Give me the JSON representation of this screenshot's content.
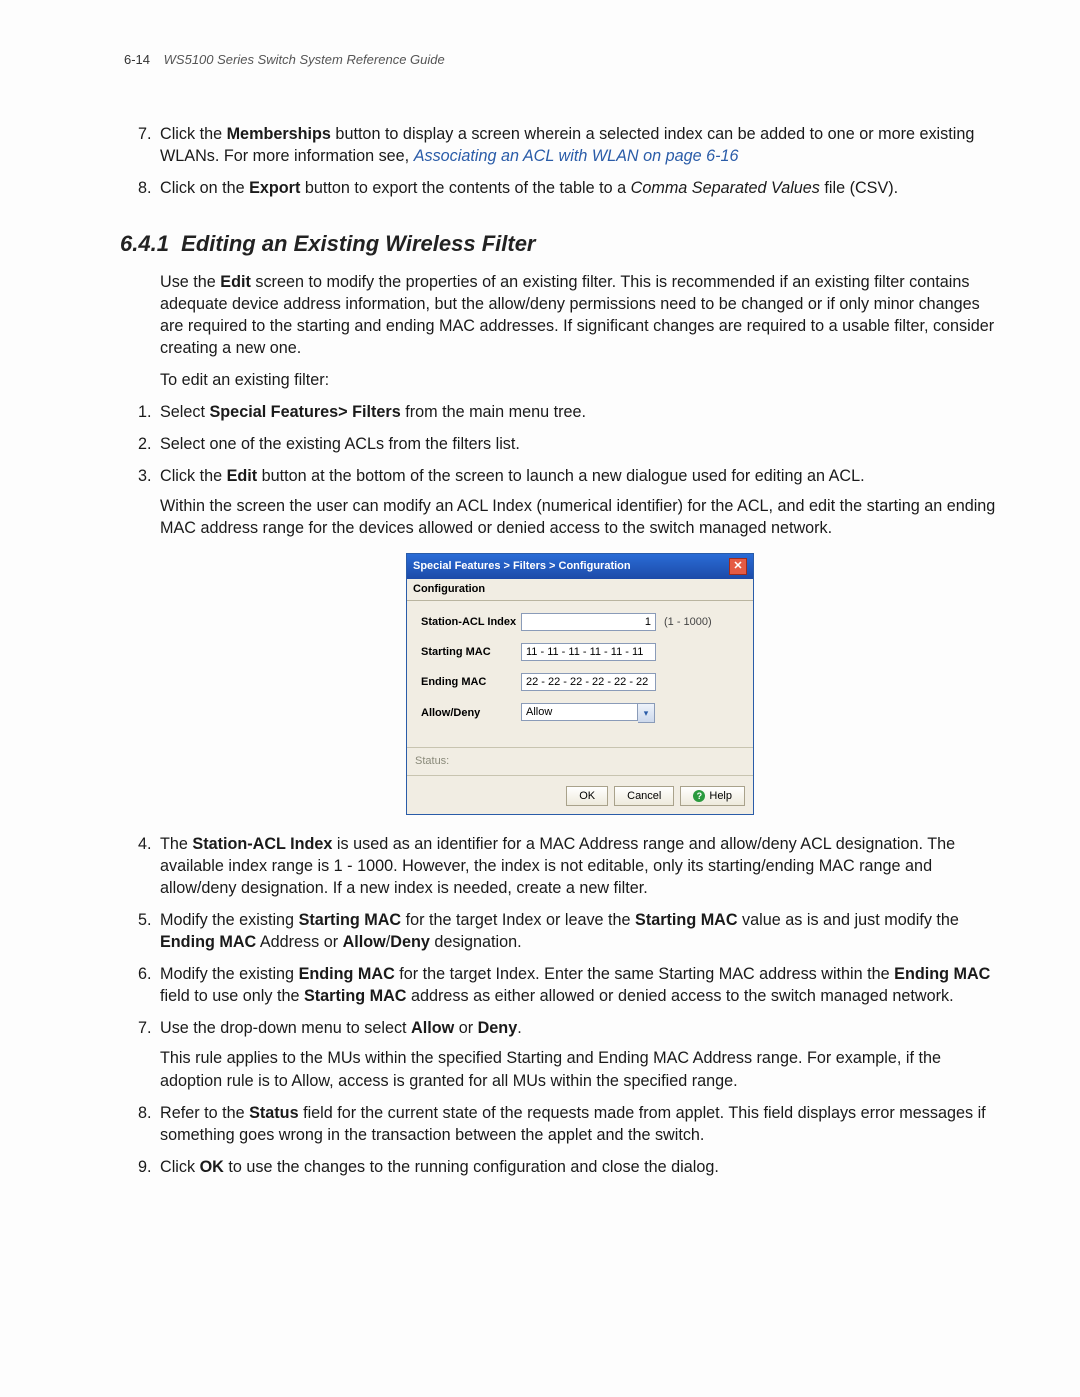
{
  "header": {
    "page_num": "6-14",
    "doc_title": "WS5100 Series Switch System Reference Guide"
  },
  "list_a": {
    "item7_num": "7.",
    "item7_a": "Click the ",
    "item7_b": "Memberships",
    "item7_c": " button to display a screen wherein a selected index can be added to one or more existing WLANs. For more information see, ",
    "item7_link": "Associating an ACL with WLAN on page 6-16",
    "item8_num": "8.",
    "item8_a": "Click on the ",
    "item8_b": "Export",
    "item8_c": " button to export the contents of the table to a ",
    "item8_d": "Comma Separated Values",
    "item8_e": " file (CSV)."
  },
  "section": {
    "num": "6.4.1",
    "title": "Editing an Existing Wireless Filter"
  },
  "intro": {
    "a": "Use the ",
    "b": "Edit",
    "c": " screen to modify the properties of an existing filter. This is recommended if an existing filter contains adequate device address information, but the allow/deny permissions need to be changed or if only minor changes are required to the starting and ending MAC addresses. If significant changes are required to a usable filter, consider creating a new one.",
    "lead2": "To edit an existing filter:"
  },
  "steps": {
    "s1_num": "1.",
    "s1_a": "Select ",
    "s1_b": "Special Features> Filters",
    "s1_c": " from the main menu tree.",
    "s2_num": "2.",
    "s2": "Select one of the existing ACLs from the filters list.",
    "s3_num": "3.",
    "s3_a": "Click the ",
    "s3_b": "Edit",
    "s3_c": " button at the bottom of the screen to launch a new dialogue used for editing an ACL.",
    "s3_para": "Within the screen the user can modify an ACL Index (numerical identifier) for the ACL, and edit the starting an ending MAC address range for the devices allowed or denied access to the switch managed network.",
    "s4_num": "4.",
    "s4_a": "The ",
    "s4_b": "Station-ACL Index",
    "s4_c": " is used as an identifier for a MAC Address range and allow/deny ACL designation. The available index range is 1 - 1000. However, the index is not editable, only its starting/ending MAC range and allow/deny designation. If a new index is needed, create a new filter.",
    "s5_num": "5.",
    "s5_a": "Modify the existing ",
    "s5_b": "Starting MAC",
    "s5_c": " for the target Index or leave the ",
    "s5_d": "Starting MAC",
    "s5_e": " value as is and just modify the ",
    "s5_f": "Ending MAC",
    "s5_g": " Address or ",
    "s5_h": "Allow",
    "s5_i": "/",
    "s5_j": "Deny",
    "s5_k": " designation.",
    "s6_num": "6.",
    "s6_a": "Modify the existing ",
    "s6_b": "Ending MAC",
    "s6_c": " for the target Index. Enter the same Starting MAC address within the ",
    "s6_d": "Ending MAC",
    "s6_e": " field to use only the ",
    "s6_f": "Starting MAC",
    "s6_g": " address as either allowed or denied access to the switch managed network.",
    "s7_num": "7.",
    "s7_a": "Use the drop-down menu to select ",
    "s7_b": "Allow",
    "s7_c": " or ",
    "s7_d": "Deny",
    "s7_e": ".",
    "s7_para": "This rule applies to the MUs within the specified Starting and Ending MAC Address range. For example, if the adoption rule is to Allow, access is granted for all MUs within the specified range.",
    "s8_num": "8.",
    "s8_a": "Refer to the ",
    "s8_b": "Status",
    "s8_c": " field for the current state of the requests made from applet. This field displays error messages if something goes wrong in the transaction between the applet and the switch.",
    "s9_num": "9.",
    "s9_a": "Click ",
    "s9_b": "OK",
    "s9_c": " to use the changes to the running configuration and close the dialog."
  },
  "dialog": {
    "title": "Special Features > Filters > Configuration",
    "close": "✕",
    "sub": "Configuration",
    "lbl_index": "Station-ACL Index",
    "val_index": "1",
    "hint_index": "(1 - 1000)",
    "lbl_start": "Starting MAC",
    "val_start": "11 - 11 - 11 - 11 - 11 - 11",
    "lbl_end": "Ending MAC",
    "val_end": "22 - 22 - 22 - 22 - 22 - 22",
    "lbl_ad": "Allow/Deny",
    "val_ad": "Allow",
    "status_lbl": "Status:",
    "btn_ok": "OK",
    "btn_cancel": "Cancel",
    "btn_help": "Help"
  }
}
